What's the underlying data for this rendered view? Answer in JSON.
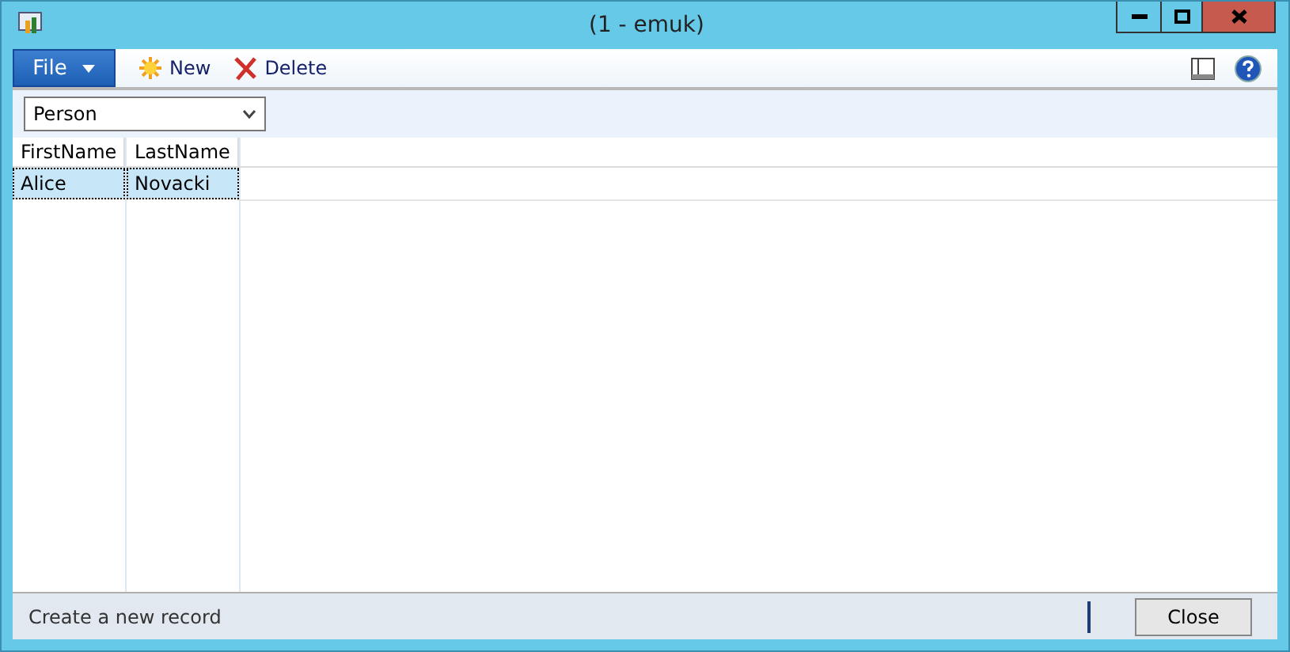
{
  "window": {
    "title": "(1 - emuk)"
  },
  "toolbar": {
    "file_label": "File",
    "buttons": [
      {
        "kind": "new",
        "label": "New"
      },
      {
        "kind": "delete",
        "label": "Delete"
      }
    ]
  },
  "filter": {
    "value": "Person"
  },
  "table": {
    "columns": [
      "FirstName",
      "LastName"
    ],
    "rows": [
      {
        "cells": [
          "Alice",
          "Novacki"
        ],
        "selected": true
      }
    ]
  },
  "status_bar": {
    "text": "Create a new record",
    "button": "Close"
  }
}
